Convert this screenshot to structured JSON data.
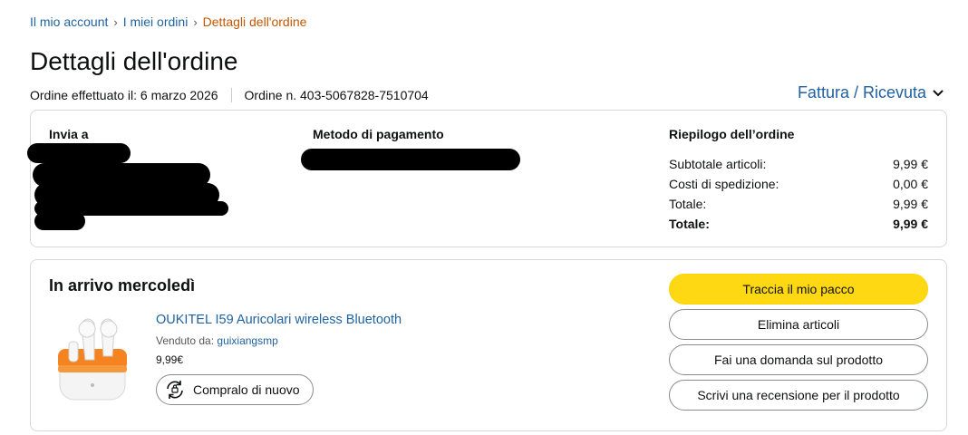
{
  "breadcrumb": {
    "items": [
      "Il mio account",
      "I miei ordini"
    ],
    "separator": "›",
    "current": "Dettagli dell'ordine"
  },
  "header": {
    "title": "Dettagli dell'ordine",
    "order_date": "Ordine effettuato il: 6 marzo 2026",
    "order_number": "Ordine n. 403-5067828-7510704",
    "invoice_link": "Fattura / Ricevuta"
  },
  "summary": {
    "ship_to_title": "Invia a",
    "payment_title": "Metodo di pagamento",
    "order_summary_title": "Riepilogo dell’ordine",
    "rows": [
      {
        "label": "Subtotale articoli:",
        "value": "9,99 €"
      },
      {
        "label": "Costi di spedizione:",
        "value": "0,00 €"
      },
      {
        "label": "Totale:",
        "value": "9,99 €"
      },
      {
        "label": "Totale:",
        "value": "9,99 €"
      }
    ]
  },
  "shipment": {
    "arrival_title": "In arrivo mercoledì",
    "product_name": "OUKITEL I59 Auricolari wireless Bluetooth",
    "sold_by_label": "Venduto da:",
    "seller": "guixiangsmp",
    "price": "9,99€",
    "buy_again_label": "Compralo di nuovo",
    "actions": {
      "track": "Traccia il mio pacco",
      "delete": "Elimina articoli",
      "question": "Fai una domanda sul prodotto",
      "review": "Scrivi una recensione per il prodotto"
    }
  },
  "colors": {
    "link": "#2162a1",
    "breadcrumb_current": "#c45500",
    "primary_button": "#ffd814",
    "border": "#d5d9d9"
  },
  "icons": {
    "invoice": "chevron-down-icon",
    "buy_again": "buy-again-cycle-icon"
  }
}
